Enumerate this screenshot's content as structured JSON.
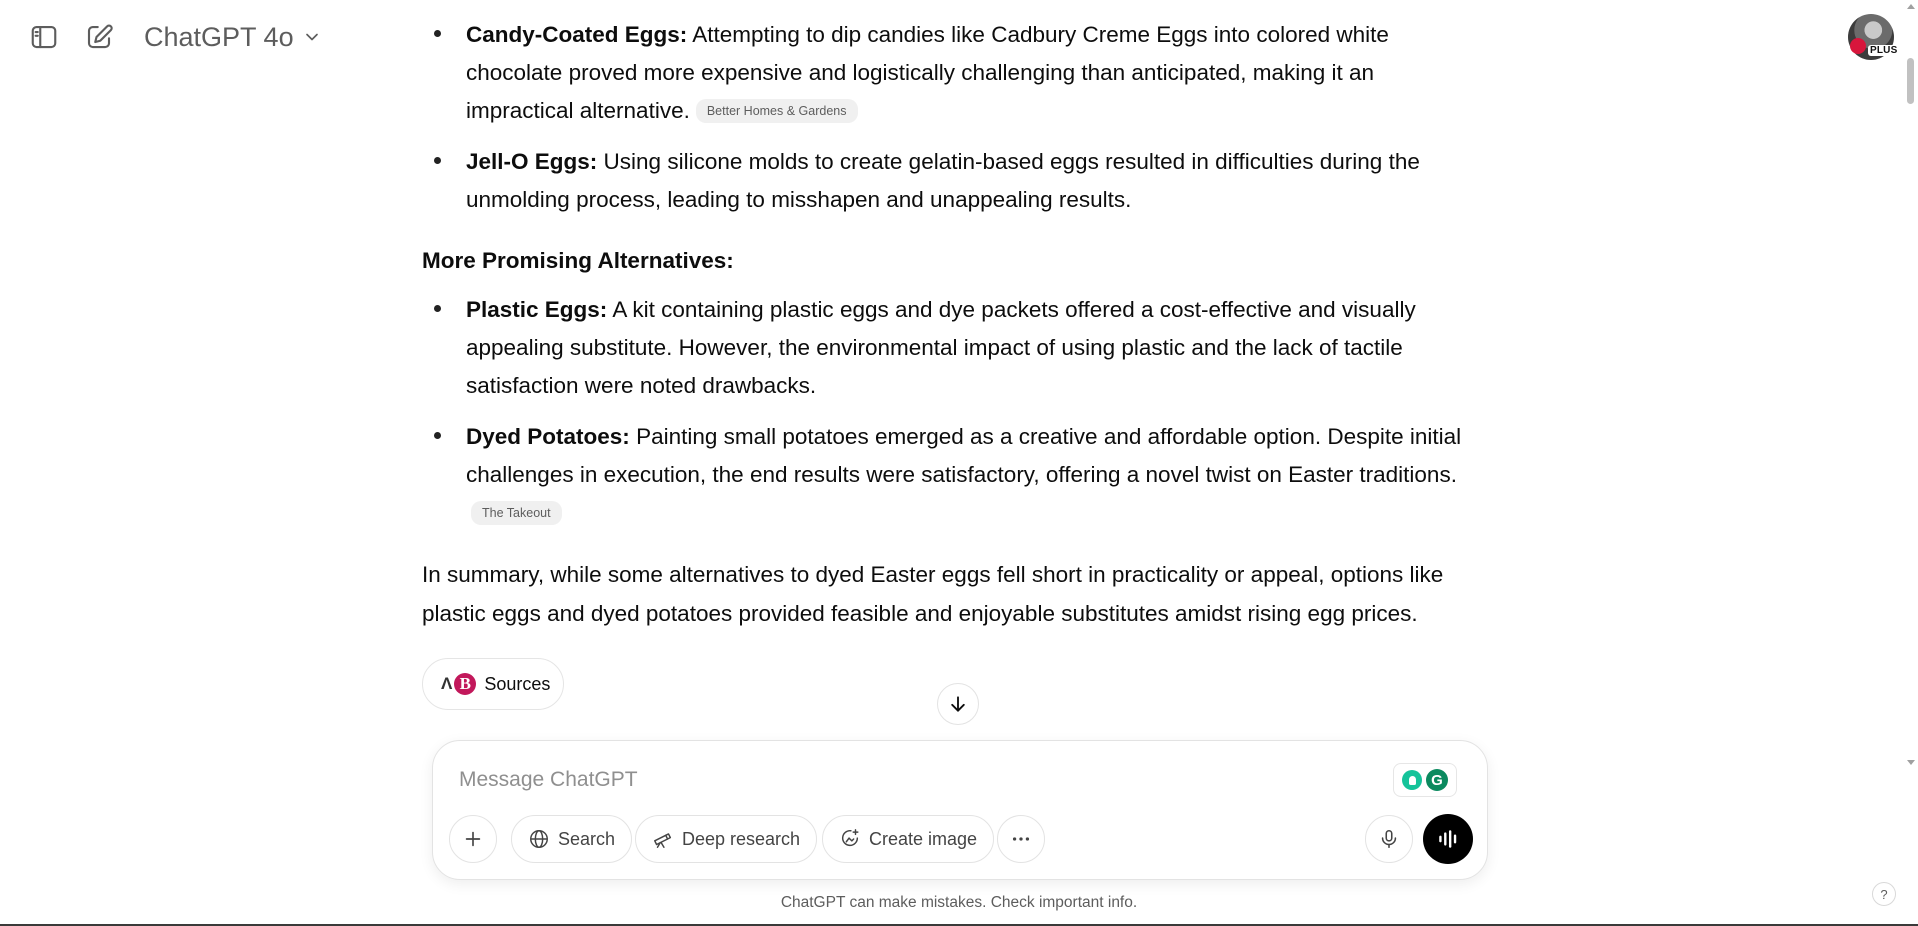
{
  "header": {
    "model_name": "ChatGPT 4o",
    "plus_badge": "PLUS"
  },
  "message": {
    "items_top": [
      {
        "title": "Candy-Coated Eggs:",
        "text": "Attempting to dip candies like Cadbury Creme Eggs into colored white chocolate proved more expensive and logistically challenging than anticipated, making it an impractical alternative.",
        "citation": "Better Homes & Gardens"
      },
      {
        "title": "Jell-O Eggs:",
        "text": "Using silicone molds to create gelatin-based eggs resulted in difficulties during the unmolding process, leading to misshapen and unappealing results."
      }
    ],
    "heading": "More Promising Alternatives:",
    "items_bottom": [
      {
        "title": "Plastic Eggs:",
        "text": "A kit containing plastic eggs and dye packets offered a cost-effective and visually appealing substitute. However, the environmental impact of using plastic and the lack of tactile satisfaction were noted drawbacks."
      },
      {
        "title": "Dyed Potatoes:",
        "text": "Painting small potatoes emerged as a creative and affordable option. Despite initial challenges in execution, the end results were satisfactory, offering a novel twist on Easter traditions.",
        "citation": "The Takeout"
      }
    ],
    "summary": "In summary, while some alternatives to dyed Easter eggs fell short in practicality or appeal, options like plastic eggs and dyed potatoes provided feasible and enjoyable substitutes amidst rising egg prices."
  },
  "sources": {
    "label": "Sources",
    "icons": [
      "A",
      "B"
    ]
  },
  "composer": {
    "placeholder": "Message ChatGPT",
    "value": "",
    "tools": {
      "search": "Search",
      "deep_research": "Deep research",
      "create_image": "Create image"
    }
  },
  "footer": {
    "disclaimer": "ChatGPT can make mistakes. Check important info.",
    "help": "?"
  },
  "icons": {
    "sidebar_toggle": "sidebar-toggle-icon",
    "new_chat": "new-chat-icon",
    "chevron": "chevron-down-icon",
    "scroll_down": "arrow-down-icon",
    "attach": "plus-icon",
    "search": "globe-icon",
    "deep_research": "telescope-icon",
    "create_image": "image-sparkle-icon",
    "more": "more-horizontal-icon",
    "mic": "microphone-icon",
    "voice": "voice-mode-icon"
  },
  "colors": {
    "text": "#0d0d0d",
    "muted": "#5d5d5d",
    "citation_bg": "#f0f0f0",
    "voice_button": "#000000",
    "grammarly": "#15c39a"
  }
}
